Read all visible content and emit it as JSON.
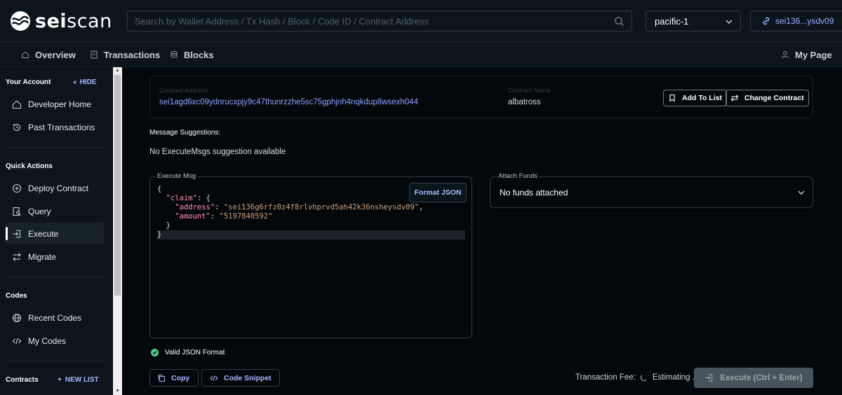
{
  "header": {
    "logo": {
      "prefix": "sei",
      "suffix": "scan"
    },
    "search_placeholder": "Search by Wallet Address / Tx Hash / Block / Code ID / Contract Address",
    "network": "pacific-1",
    "wallet": "sei136...ysdv09"
  },
  "nav": {
    "overview": "Overview",
    "transactions": "Transactions",
    "blocks": "Blocks",
    "my_page": "My Page"
  },
  "sidebar": {
    "your_account": "Your Account",
    "hide": "HIDE",
    "developer_home": "Developer Home",
    "past_transactions": "Past Transactions",
    "quick_actions": "Quick Actions",
    "deploy_contract": "Deploy Contract",
    "query": "Query",
    "execute": "Execute",
    "migrate": "Migrate",
    "codes": "Codes",
    "recent_codes": "Recent Codes",
    "my_codes": "My Codes",
    "contracts": "Contracts",
    "new_list": "NEW LIST"
  },
  "contract": {
    "address_label": "Contract Address",
    "address": "sei1agd6xc09ydnrucxpjy9c47thunrzzhe5sc75gphjnh4nqkdup8wsexh044",
    "name_label": "Contract Name",
    "name": "albatross",
    "add_to_list": "Add To List",
    "change_contract": "Change Contract"
  },
  "suggestions": {
    "title": "Message Suggestions:",
    "empty": "No ExecuteMsgs suggestion available"
  },
  "execute_msg": {
    "label": "Execute Msg",
    "format_button": "Format JSON",
    "code": {
      "open": "{",
      "claim_key": "\"claim\"",
      "claim_open": ": {",
      "address_key": "\"address\"",
      "address_value": "\"sei136g6rfz0z4f8rlvhprvd5ah42k36nsheysdv09\"",
      "amount_key": "\"amount\"",
      "amount_value": "\"5197840592\"",
      "claim_close": "}",
      "close": "}"
    },
    "valid_status": "Valid JSON Format"
  },
  "attach_funds": {
    "label": "Attach Funds",
    "value": "No funds attached"
  },
  "actions": {
    "copy": "Copy",
    "code_snippet": "Code Snippet",
    "fee_label": "Transaction Fee:",
    "fee_value": "Estimating ...",
    "execute": "Execute (Ctrl + Enter)"
  },
  "colors": {
    "background": "#05080b",
    "panel": "#0c151c",
    "accent": "#8da3ff",
    "valid": "#58c78b"
  }
}
